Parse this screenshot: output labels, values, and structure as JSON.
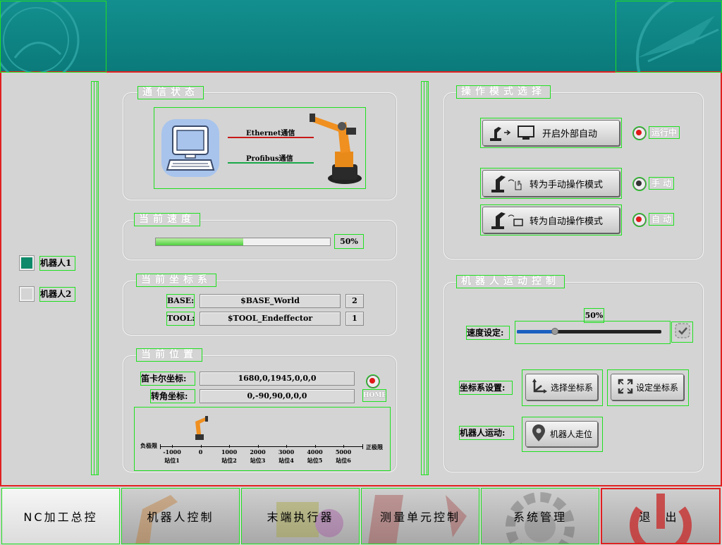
{
  "sidebar": {
    "robots": [
      {
        "label": "机器人1",
        "checked": true
      },
      {
        "label": "机器人2",
        "checked": false
      }
    ]
  },
  "comm": {
    "title": "通信状态",
    "ethernet_label": "Ethernet通信",
    "profibus_label": "Profibus通信",
    "ethernet_color": "#c81818",
    "profibus_color": "#18a848"
  },
  "speed": {
    "title": "当前速度",
    "progress": 0.5,
    "value_label": "50%"
  },
  "coords": {
    "title": "当前坐标系",
    "base_label": "BASE:",
    "base_value": "$BASE_World",
    "base_index": "2",
    "tool_label": "TOOL:",
    "tool_value": "$TOOL_Endeffector",
    "tool_index": "1"
  },
  "position": {
    "title": "当前位置",
    "cartesian_label": "笛卡尔坐标:",
    "cartesian_value": "1680,0,1945,0,0,0",
    "joint_label": "转角坐标:",
    "joint_value": "0,-90,90,0,0,0",
    "home_label": "HOME",
    "track": {
      "neg_limit": "负极限",
      "pos_limit": "正极限",
      "ticks": [
        {
          "value": "-1000",
          "station": "站位1"
        },
        {
          "value": "0",
          "station": ""
        },
        {
          "value": "1000",
          "station": "站位2"
        },
        {
          "value": "2000",
          "station": "站位3"
        },
        {
          "value": "3000",
          "station": "站位4"
        },
        {
          "value": "4000",
          "station": "站位5"
        },
        {
          "value": "5000",
          "station": "站位6"
        }
      ],
      "robot_position": 0
    }
  },
  "mode": {
    "title": "操作模式选择",
    "ext_auto_label": "开启外部自动",
    "ext_auto_status": "运行中",
    "manual_label": "转为手动操作模式",
    "manual_status": "手 动",
    "auto_label": "转为自动操作模式",
    "auto_status": "自 动"
  },
  "motion": {
    "title": "机器人运动控制",
    "speed_label": "速度设定:",
    "speed_value": "50%",
    "speed_fraction": 0.5,
    "coord_label": "坐标系设置:",
    "select_coord_label": "选择坐标系",
    "set_coord_label": "设定坐标系",
    "move_label": "机器人运动:",
    "move_button_label": "机器人走位"
  },
  "nav": [
    {
      "label": "NC加工总控"
    },
    {
      "label": "机器人控制"
    },
    {
      "label": "末端执行器"
    },
    {
      "label": "测量单元控制"
    },
    {
      "label": "系统管理"
    },
    {
      "label": "退  出"
    }
  ],
  "colors": {
    "header": "#138f8f",
    "frame_border": "#e02020",
    "accent_green": "#20e020",
    "checked": "#0e8a6a"
  }
}
